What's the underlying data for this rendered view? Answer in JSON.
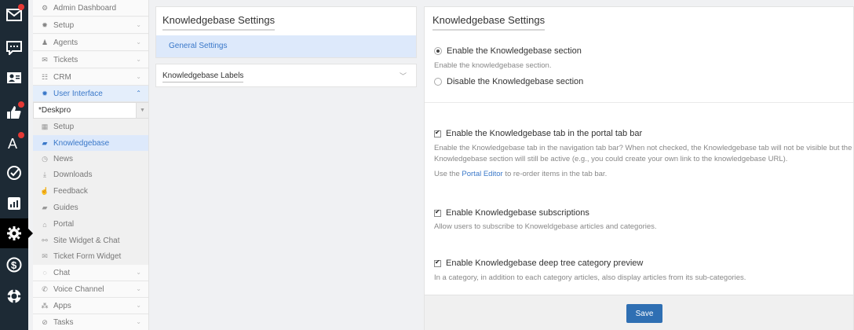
{
  "rail": [
    {
      "icon": "mail-icon",
      "badge": true
    },
    {
      "icon": "chat-bubble-icon",
      "badge": false
    },
    {
      "icon": "contact-card-icon",
      "badge": false
    },
    {
      "icon": "thumbs-up-icon",
      "badge": true
    },
    {
      "icon": "text-a-icon",
      "badge": true
    },
    {
      "icon": "check-circle-icon",
      "badge": false
    },
    {
      "icon": "bar-chart-icon",
      "badge": false
    },
    {
      "icon": "gear-icon",
      "badge": false
    },
    {
      "icon": "dollar-icon",
      "badge": false
    },
    {
      "icon": "lifebuoy-icon",
      "badge": false
    }
  ],
  "nav": {
    "admin_dashboard": "Admin Dashboard",
    "setup": "Setup",
    "agents": "Agents",
    "tickets": "Tickets",
    "crm": "CRM",
    "user_interface": "User Interface",
    "brand_select": "*Deskpro",
    "sub": {
      "setup": "Setup",
      "knowledgebase": "Knowledgebase",
      "news": "News",
      "downloads": "Downloads",
      "feedback": "Feedback",
      "guides": "Guides",
      "portal": "Portal",
      "site_widget": "Site Widget & Chat",
      "ticket_form_widget": "Ticket Form Widget"
    },
    "chat": "Chat",
    "voice_channel": "Voice Channel",
    "apps": "Apps",
    "tasks": "Tasks"
  },
  "mid": {
    "title": "Knowledgebase Settings",
    "general": "General Settings",
    "labels": "Knowledgebase Labels"
  },
  "right": {
    "title": "Knowledgebase Settings",
    "enable_section": "Enable the Knowledgebase section",
    "enable_section_desc": "Enable the knowledgebase section.",
    "disable_section": "Disable the Knowledgebase section",
    "tab_bar": "Enable the Knowledgebase tab in the portal tab bar",
    "tab_bar_desc_1": "Enable the Knowledgebase tab in the navigation tab bar? When not checked, the Knowledgebase tab will not be visible but the",
    "tab_bar_desc_2": "Knowledgebase section will still be active (e.g., you could create your own link to the knowledgebase URL).",
    "portal_use": "Use the",
    "portal_link": "Portal Editor",
    "portal_rest": "to re-order items in the tab bar.",
    "subscriptions": "Enable Knowledgebase subscriptions",
    "subscriptions_desc": "Allow users to subscribe to Knoweldgebase articles and categories.",
    "deep_tree": "Enable Knowledgebase deep tree category preview",
    "deep_tree_desc": "In a category, in addition to each category articles, also display articles from its sub-categories.",
    "save": "Save"
  }
}
